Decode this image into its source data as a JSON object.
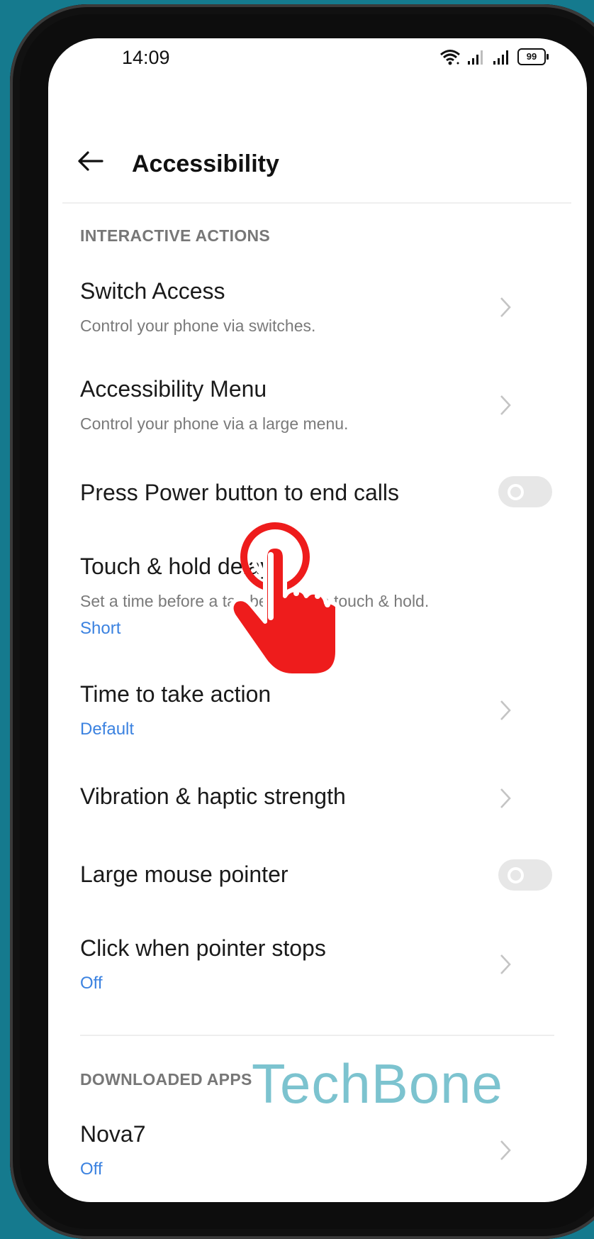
{
  "status_bar": {
    "time": "14:09",
    "battery": "99",
    "icons": [
      "wifi-icon",
      "signal-icon",
      "signal-icon",
      "battery-icon"
    ]
  },
  "header": {
    "title": "Accessibility",
    "back_icon": "arrow-left-icon"
  },
  "sections": {
    "interactive": "INTERACTIVE ACTIONS",
    "downloaded": "DOWNLOADED APPS"
  },
  "items": {
    "switch_access": {
      "title": "Switch Access",
      "subtitle": "Control your phone via switches."
    },
    "accessibility_menu": {
      "title": "Accessibility Menu",
      "subtitle": "Control your phone via a large menu."
    },
    "press_power": {
      "title": "Press Power button to end calls",
      "toggle_on": false
    },
    "touch_hold": {
      "title": "Touch & hold delay",
      "subtitle": "Set a time before a tap becomes a touch & hold.",
      "value": "Short"
    },
    "time_to_act": {
      "title": "Time to take action",
      "value": "Default"
    },
    "vibration": {
      "title": "Vibration & haptic strength"
    },
    "large_pointer": {
      "title": "Large mouse pointer",
      "toggle_on": false
    },
    "click_pointer": {
      "title": "Click when pointer stops",
      "value": "Off"
    },
    "nova7": {
      "title": "Nova7",
      "value": "Off"
    }
  },
  "watermark": "TechBone",
  "colors": {
    "background": "#157a8e",
    "accent": "#3b82e0",
    "tap_indicator": "#ee1c1c",
    "watermark": "#7cc3cf"
  }
}
